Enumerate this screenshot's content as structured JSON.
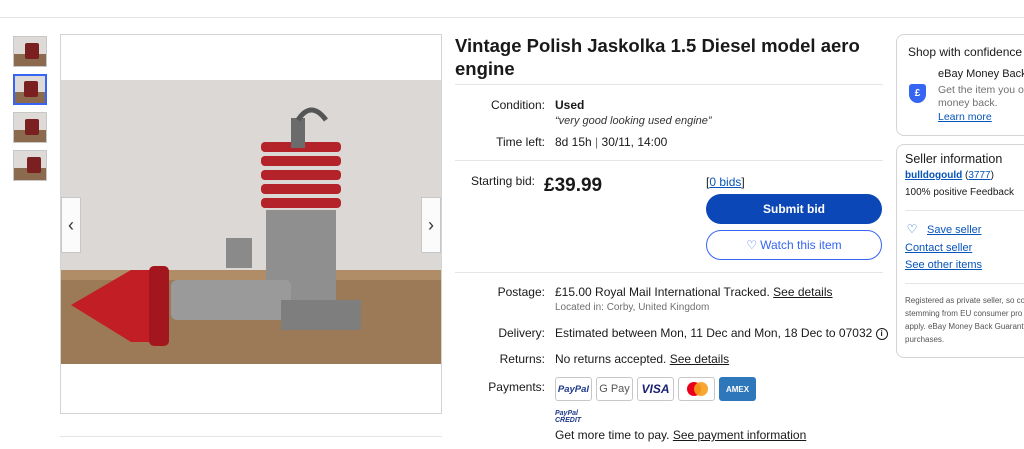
{
  "item": {
    "title": "Vintage Polish Jaskolka 1.5 Diesel model aero engine"
  },
  "details": {
    "condition_label": "Condition:",
    "condition_value": "Used",
    "condition_note": "“very good looking used engine”",
    "time_left_label": "Time left:",
    "time_left_value": "8d 15h",
    "time_left_sep": "|",
    "time_left_end": "30/11, 14:00"
  },
  "bid": {
    "starting_label": "Starting bid:",
    "price": "£39.99",
    "bids_open": "[",
    "bids_link": "0 bids",
    "bids_close": "]",
    "submit_label": "Submit bid",
    "watch_label": "Watch this item",
    "watch_icon": "heart-icon"
  },
  "shipping": {
    "postage_label": "Postage:",
    "postage_price": "£15.00",
    "postage_service": "Royal Mail International Tracked.",
    "postage_link": "See details",
    "location": "Located in: Corby, United Kingdom",
    "delivery_label": "Delivery:",
    "delivery_text": "Estimated between Mon, 11 Dec and Mon, 18 Dec to 07032",
    "delivery_info_icon": "info-icon",
    "returns_label": "Returns:",
    "returns_text": "No returns accepted.",
    "returns_link": "See details"
  },
  "payments": {
    "label": "Payments:",
    "methods": [
      "PayPal",
      "G Pay",
      "VISA",
      "Mastercard",
      "AMEX"
    ],
    "credit_line1": "PayPal",
    "credit_line2": "CREDIT",
    "credit_text": "Get more time to pay.",
    "credit_link": "See payment information"
  },
  "shop": {
    "heading": "Shop with confidence",
    "guarantee_title": "eBay Money Back",
    "guarantee_desc_1": "Get the item you o",
    "guarantee_desc_2": "money back.",
    "learn_more": "Learn more"
  },
  "seller": {
    "heading": "Seller information",
    "username": "bulldogould",
    "feedback_open": "(",
    "feedback_score": "3777",
    "feedback_close": ")",
    "positive": "100% positive Feedback",
    "save_seller": "Save seller",
    "contact_seller": "Contact seller",
    "see_other": "See other items",
    "note_1": "Registered as private seller, so co",
    "note_2": "stemming from EU consumer pro",
    "note_3": "apply. eBay Money Back Guarant",
    "note_4": "purchases."
  },
  "colors": {
    "primary_button": "#0c47b7",
    "link": "#0654ba",
    "accent": "#3665f3"
  }
}
